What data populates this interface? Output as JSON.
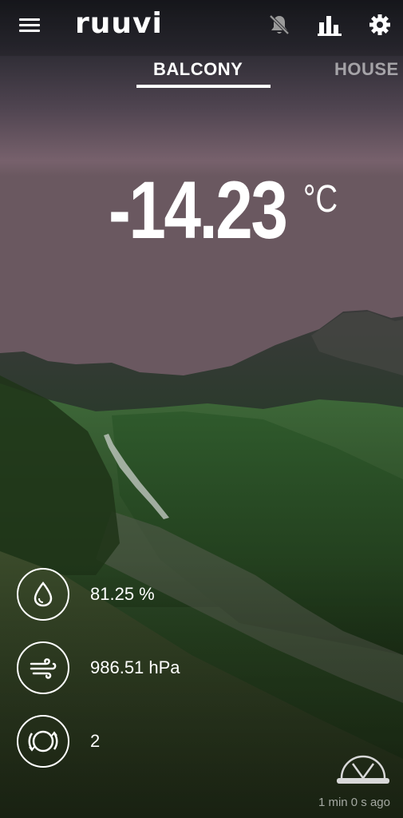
{
  "app": {
    "logo_text": "ruuvi"
  },
  "header": {
    "icons": [
      "menu-icon",
      "alert-off-bell-icon",
      "bar-chart-icon",
      "gear-icon"
    ]
  },
  "tabs": [
    {
      "label": "BALCONY",
      "active": true
    },
    {
      "label": "HOUSE",
      "active": false
    }
  ],
  "temperature": {
    "value": "-14.23",
    "unit": "°C"
  },
  "sensors": [
    {
      "icon": "water-drop-icon",
      "value": "81.25 %"
    },
    {
      "icon": "wind-icon",
      "value": "986.51 hPa"
    },
    {
      "icon": "movement-icon",
      "value": "2"
    }
  ],
  "status": {
    "icon": "gateway-signal-icon",
    "updated": "1 min 0 s ago"
  },
  "colors": {
    "text": "#ffffff",
    "muted_text": "#bfbfbf"
  }
}
